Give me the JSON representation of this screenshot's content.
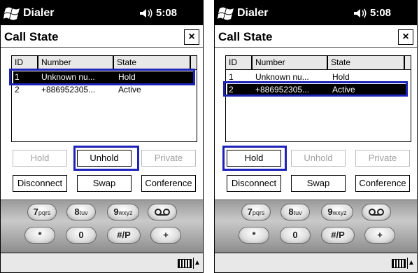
{
  "screens": [
    {
      "app_title": "Dialer",
      "time": "5:08",
      "page_title": "Call State",
      "close_label": "×",
      "columns": [
        "ID",
        "Number",
        "State"
      ],
      "rows": [
        {
          "id": "1",
          "number": "Unknown nu...",
          "state": "Hold",
          "selected": true
        },
        {
          "id": "2",
          "number": "+886952305...",
          "state": "Active",
          "selected": false
        }
      ],
      "buttons": {
        "hold": "Hold",
        "unhold": "Unhold",
        "private": "Private",
        "disconnect": "Disconnect",
        "swap": "Swap",
        "conference": "Conference"
      },
      "enabled": {
        "hold": false,
        "unhold": true,
        "private": false
      },
      "highlighted_button": "unhold"
    },
    {
      "app_title": "Dialer",
      "time": "5:08",
      "page_title": "Call State",
      "close_label": "×",
      "columns": [
        "ID",
        "Number",
        "State"
      ],
      "rows": [
        {
          "id": "1",
          "number": "Unknown nu...",
          "state": "Hold",
          "selected": false
        },
        {
          "id": "2",
          "number": "+886952305...",
          "state": "Active",
          "selected": true
        }
      ],
      "buttons": {
        "hold": "Hold",
        "unhold": "Unhold",
        "private": "Private",
        "disconnect": "Disconnect",
        "swap": "Swap",
        "conference": "Conference"
      },
      "enabled": {
        "hold": true,
        "unhold": false,
        "private": false
      },
      "highlighted_button": "hold"
    }
  ],
  "keypad": {
    "row1": [
      {
        "digit": "7",
        "letters": "pqrs"
      },
      {
        "digit": "8",
        "letters": "tuv"
      },
      {
        "digit": "9",
        "letters": "wxyz"
      },
      {
        "digit": "voicemail-icon",
        "letters": ""
      }
    ],
    "row2": [
      "*",
      "0",
      "#/P",
      "+"
    ]
  },
  "icons": {
    "logo": "windows-flag-icon",
    "volume": "speaker-icon",
    "input": "keyboard-icon"
  },
  "colors": {
    "titlebar": "#000000",
    "selection": "#000000",
    "highlight_outline": "#1d22b8",
    "disabled_text": "#a0a0a0"
  }
}
